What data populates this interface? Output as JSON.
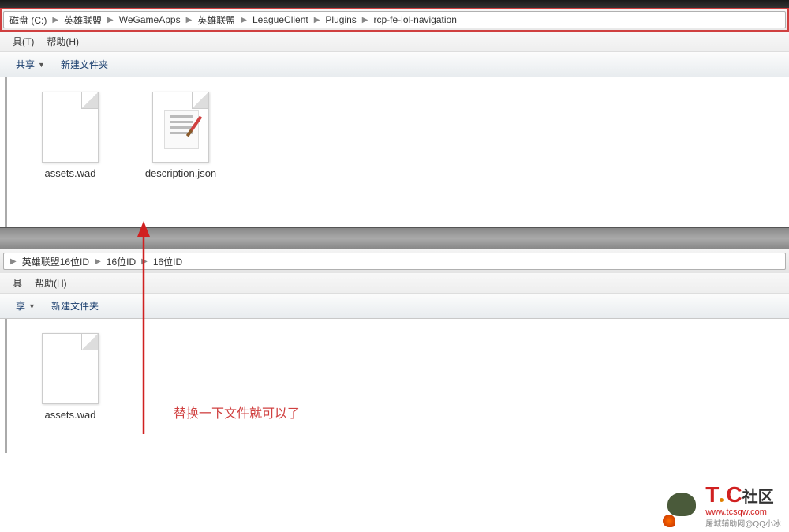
{
  "window1": {
    "breadcrumb": {
      "drive": "磁盘 (C:)",
      "items": [
        "英雄联盟",
        "WeGameApps",
        "英雄联盟",
        "LeagueClient",
        "Plugins",
        "rcp-fe-lol-navigation"
      ]
    },
    "menu": {
      "tools": "具(T)",
      "help": "帮助(H)"
    },
    "toolbar": {
      "share": "共享",
      "newfolder": "新建文件夹"
    },
    "files": [
      {
        "name": "assets.wad",
        "type": "generic"
      },
      {
        "name": "description.json",
        "type": "json"
      }
    ]
  },
  "window2": {
    "breadcrumb": {
      "items": [
        "英雄联盟16位ID",
        "16位ID",
        "16位ID"
      ]
    },
    "menu": {
      "tools": "具",
      "help": "帮助(H)"
    },
    "toolbar": {
      "share": "享",
      "newfolder": "新建文件夹"
    },
    "files": [
      {
        "name": "assets.wad",
        "type": "generic"
      }
    ]
  },
  "annotation": "替换一下文件就可以了",
  "watermark": {
    "brand_left": "T",
    "brand_right": "C",
    "brand_cn": "社区",
    "url": "www.tcsqw.com",
    "sub": "屠城辅助网@QQ小冰"
  }
}
